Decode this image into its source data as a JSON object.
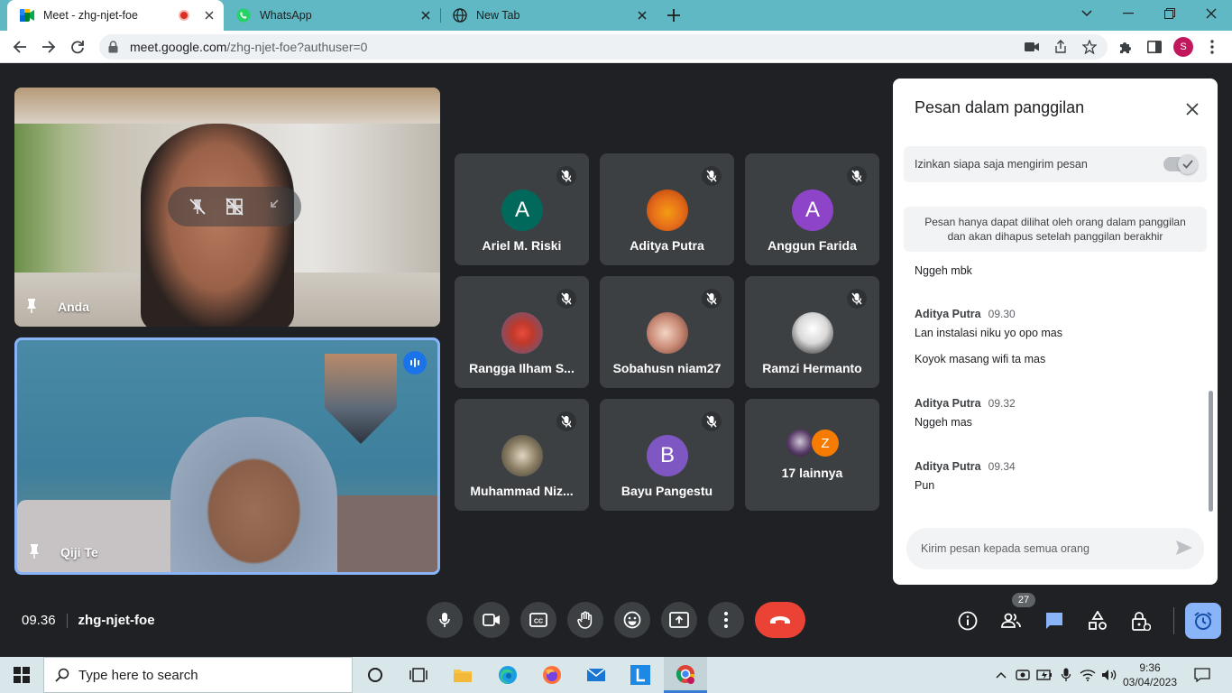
{
  "browser": {
    "tabs": [
      {
        "title": "Meet - zhg-njet-foe",
        "active": true,
        "recording": true
      },
      {
        "title": "WhatsApp",
        "active": false
      },
      {
        "title": "New Tab",
        "active": false
      }
    ],
    "url_host": "meet.google.com",
    "url_path": "/zhg-njet-foe?authuser=0",
    "profile_initial": "S"
  },
  "stage": {
    "self_video": {
      "name": "Anda"
    },
    "spotlight_video": {
      "name": "Qiji Te"
    },
    "participants": [
      {
        "name": "Ariel M. Riski",
        "initial": "A",
        "avatar_color": "#00695c"
      },
      {
        "name": "Aditya Putra",
        "initial": "",
        "avatar_color": "#e8711a"
      },
      {
        "name": "Anggun Farida",
        "initial": "A",
        "avatar_color": "#8e44c9"
      },
      {
        "name": "Rangga Ilham S...",
        "initial": "",
        "avatar_color": "#c0392b"
      },
      {
        "name": "Sobahusn niam27",
        "initial": "",
        "avatar_color": "#a56b56"
      },
      {
        "name": "Ramzi Hermanto",
        "initial": "",
        "avatar_color": "#e0e0e0"
      },
      {
        "name": "Muhammad Niz...",
        "initial": "",
        "avatar_color": "#6d6a5c"
      },
      {
        "name": "Bayu Pangestu",
        "initial": "B",
        "avatar_color": "#7e57c2"
      }
    ],
    "others": {
      "label": "17 lainnya",
      "avatar_initial": "Z",
      "avatar_color": "#f57c00"
    }
  },
  "chat": {
    "title": "Pesan dalam panggilan",
    "allow_label": "Izinkan siapa saja mengirim pesan",
    "notice_line1": "Pesan hanya dapat dilihat oleh orang dalam panggilan",
    "notice_line2": "dan akan dihapus setelah panggilan berakhir",
    "messages": [
      {
        "sender": "",
        "time": "",
        "texts": [
          "Nggeh mbk"
        ]
      },
      {
        "sender": "Aditya Putra",
        "time": "09.30",
        "texts": [
          "Lan instalasi niku yo opo mas",
          "Koyok masang wifi ta mas"
        ]
      },
      {
        "sender": "Aditya Putra",
        "time": "09.32",
        "texts": [
          "Nggeh mas"
        ]
      },
      {
        "sender": "Aditya Putra",
        "time": "09.34",
        "texts": [
          "Pun"
        ]
      }
    ],
    "input_placeholder": "Kirim pesan kepada semua orang"
  },
  "bottom": {
    "time": "09.36",
    "meeting_code": "zhg-njet-foe",
    "people_count": "27"
  },
  "taskbar": {
    "search_placeholder": "Type here to search",
    "time": "9:36",
    "date": "03/04/2023"
  },
  "colors": {
    "tabbar": "#5fb8c4",
    "stage_bg": "#202124",
    "end_call": "#ea4335",
    "accent_blue": "#8ab4f8"
  }
}
